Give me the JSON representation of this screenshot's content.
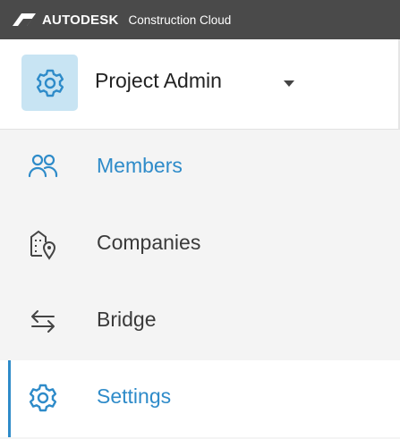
{
  "topbar": {
    "brand_name": "AUTODESK",
    "product_name": "Construction Cloud",
    "logo_icon": "autodesk-logo"
  },
  "project": {
    "title": "Project Admin",
    "icon": "gear-icon",
    "icon_bg": "#c8e4f3"
  },
  "nav": {
    "items": [
      {
        "label": "Members",
        "icon": "people-icon",
        "state": "link"
      },
      {
        "label": "Companies",
        "icon": "building-location-icon",
        "state": "default"
      },
      {
        "label": "Bridge",
        "icon": "bridge-arrows-icon",
        "state": "default"
      },
      {
        "label": "Settings",
        "icon": "gear-icon",
        "state": "active"
      }
    ]
  },
  "colors": {
    "topbar": "#4a4a4a",
    "accent": "#2e8bc9",
    "nav_bg": "#f4f4f4"
  }
}
